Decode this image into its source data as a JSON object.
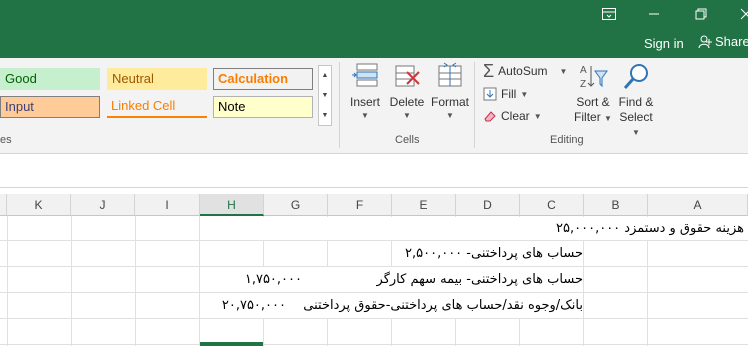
{
  "titlebar": {
    "signin": "Sign in",
    "share": "Share"
  },
  "styles": {
    "good": "Good",
    "neutral": "Neutral",
    "calculation": "Calculation",
    "input": "Input",
    "linked_cell": "Linked Cell",
    "note": "Note",
    "partial_group_label": "es"
  },
  "cells_group": {
    "insert": "Insert",
    "delete": "Delete",
    "format": "Format",
    "label": "Cells"
  },
  "editing_group": {
    "autosum": "AutoSum",
    "fill": "Fill",
    "clear": "Clear",
    "sort_filter_1": "Sort &",
    "sort_filter_2": "Filter",
    "find_select_1": "Find &",
    "find_select_2": "Select",
    "label": "Editing"
  },
  "columns": [
    "K",
    "J",
    "I",
    "H",
    "G",
    "F",
    "E",
    "D",
    "C",
    "B",
    "A"
  ],
  "selected_column": "H",
  "rows": {
    "r1": "هزینه حقوق و دستمزد ۲۵,۰۰۰,۰۰۰",
    "r2": "حساب های پرداختنی- ۲,۵۰۰,۰۰۰",
    "r3_label": "حساب های پرداختنی- بیمه سهم کارگر",
    "r3_value": "۱,۷۵۰,۰۰۰",
    "r4_label": "بانک/وجوه نقد/حساب های پرداختنی-حقوق پرداختنی",
    "r4_value": "۲۰,۷۵۰,۰۰۰"
  }
}
